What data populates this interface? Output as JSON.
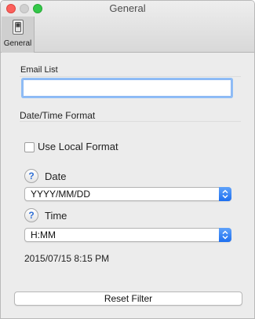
{
  "window": {
    "title": "General"
  },
  "toolbar": {
    "tabs": [
      {
        "label": "General",
        "icon": "switch-icon",
        "selected": true
      }
    ]
  },
  "email_list": {
    "label": "Email List",
    "value": ""
  },
  "date_time_format": {
    "heading": "Date/Time Format",
    "use_local_format": {
      "label": "Use Local Format",
      "checked": false
    },
    "date": {
      "label": "Date",
      "help_glyph": "?",
      "selected": "YYYY/MM/DD"
    },
    "time": {
      "label": "Time",
      "help_glyph": "?",
      "selected": "H:MM"
    },
    "preview": "2015/07/15 8:15 PM"
  },
  "reset_button_label": "Reset Filter",
  "colors": {
    "close": "#fc605c",
    "minimize": "#d0d0d0",
    "zoom": "#34c84a",
    "accent": "#1d6ff0"
  }
}
